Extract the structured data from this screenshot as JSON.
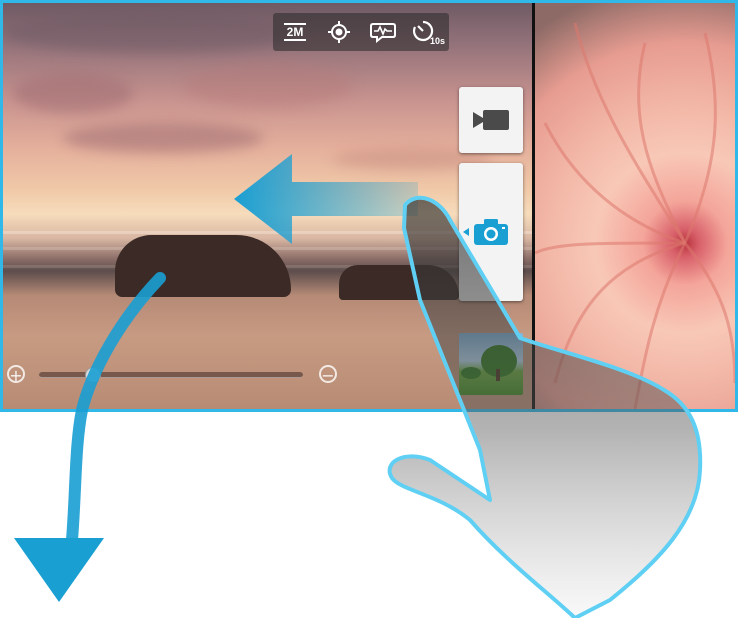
{
  "settings": {
    "resolution_label": "2M",
    "focus_icon": "focus-target-icon",
    "scene_icon": "scene-mode-icon",
    "timer_label": "10s"
  },
  "zoom": {
    "zoom_in_symbol": "+",
    "zoom_out_symbol": "−",
    "level_percent": 20
  },
  "modes": {
    "video_icon": "video-camera-icon",
    "photo_icon": "camera-icon",
    "selected": "photo"
  },
  "colors": {
    "accent": "#30b9e8",
    "arrow": "#1a9fd3"
  }
}
